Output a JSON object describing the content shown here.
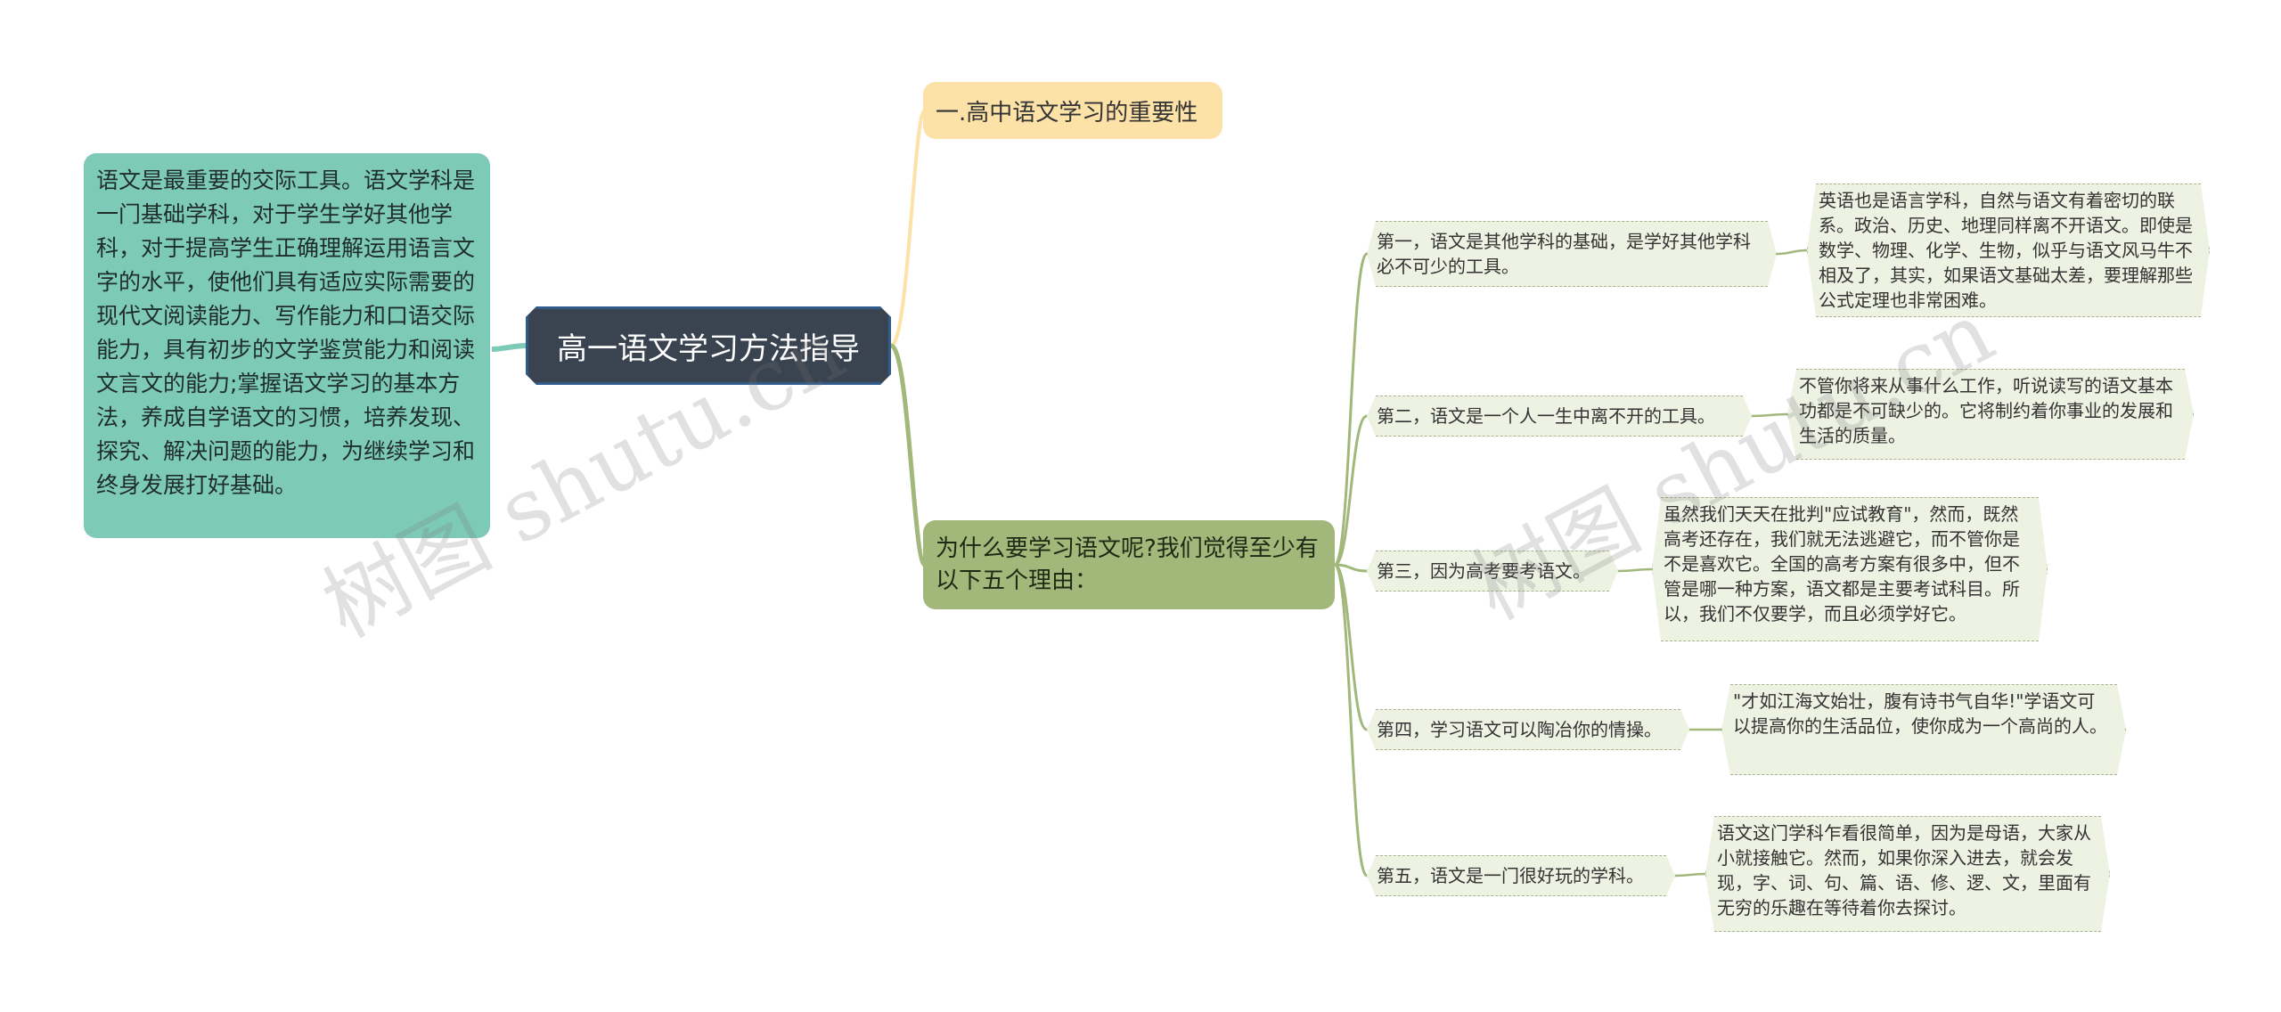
{
  "root": {
    "title": "高一语文学习方法指导"
  },
  "left_note": {
    "text": "语文是最重要的交际工具。语文学科是一门基础学科，对于学生学好其他学科，对于提高学生正确理解运用语言文字的水平，使他们具有适应实际需要的现代文阅读能力、写作能力和口语交际能力，具有初步的文学鉴赏能力和阅读文言文的能力;掌握语文学习的基本方法，养成自学语文的习惯，培养发现、探究、解决问题的能力，为继续学习和终身发展打好基础。"
  },
  "branch1": {
    "title": "一.高中语文学习的重要性"
  },
  "branch2": {
    "title": "为什么要学习语文呢?我们觉得至少有以下五个理由：",
    "reasons": [
      {
        "label": "第一，语文是其他学科的基础，是学好其他学科必不可少的工具。",
        "detail": "英语也是语言学科，自然与语文有着密切的联系。政治、历史、地理同样离不开语文。即使是数学、物理、化学、生物，似乎与语文风马牛不相及了，其实，如果语文基础太差，要理解那些公式定理也非常困难。"
      },
      {
        "label": "第二，语文是一个人一生中离不开的工具。",
        "detail": "不管你将来从事什么工作，听说读写的语文基本功都是不可缺少的。它将制约着你事业的发展和生活的质量。"
      },
      {
        "label": "第三，因为高考要考语文。",
        "detail": "虽然我们天天在批判\"应试教育\"，然而，既然高考还存在，我们就无法逃避它，而不管你是不是喜欢它。全国的高考方案有很多中，但不管是哪一种方案，语文都是主要考试科目。所以，我们不仅要学，而且必须学好它。"
      },
      {
        "label": "第四，学习语文可以陶冶你的情操。",
        "detail": "\"才如江海文始壮，腹有诗书气自华!\"学语文可以提高你的生活品位，使你成为一个高尚的人。"
      },
      {
        "label": "第五，语文是一门很好玩的学科。",
        "detail": "语文这门学科乍看很简单，因为是母语，大家从小就接触它。然而，如果你深入进去，就会发现，字、词、句、篇、语、修、逻、文，里面有无穷的乐趣在等待着你去探讨。"
      }
    ]
  },
  "watermark": {
    "text": "树图 shutu.cn"
  },
  "colors": {
    "root_bg": "#3a4350",
    "left_note_bg": "#7ecab9",
    "branch1_bg": "#fde2a8",
    "branch2_bg": "#a1b87a",
    "leaf_bg": "#eef2e3",
    "link_green": "#a1b87a",
    "link_yellow": "#fde2a8",
    "link_teal": "#7ecab9"
  }
}
